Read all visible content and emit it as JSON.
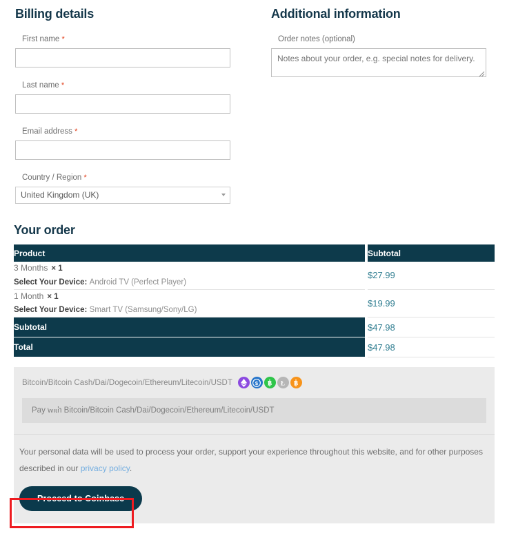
{
  "billing": {
    "title": "Billing details",
    "fields": [
      {
        "label": "First name",
        "required": "*",
        "value": "",
        "placeholder": ""
      },
      {
        "label": "Last name",
        "required": "*",
        "value": "",
        "placeholder": ""
      },
      {
        "label": "Email address",
        "required": "*",
        "value": "",
        "placeholder": ""
      }
    ],
    "country": {
      "label": "Country / Region",
      "required": "*",
      "selected": "United Kingdom (UK)",
      "caret_icon": "chevron-down-icon"
    }
  },
  "additional": {
    "title": "Additional information",
    "notes_label": "Order notes (optional)",
    "notes_value": "",
    "notes_placeholder": "Notes about your order, e.g. special notes for delivery.",
    "resize_icon": "resize-grip-icon"
  },
  "order": {
    "title": "Your order",
    "columns": {
      "product": "Product",
      "subtotal": "Subtotal"
    },
    "items": [
      {
        "name": "3 Months",
        "qty": "× 1",
        "meta_key": "Select Your Device:",
        "meta_value": "Android TV (Perfect Player)",
        "subtotal": "$27.99"
      },
      {
        "name": "1 Month",
        "qty": "× 1",
        "meta_key": "Select Your Device:",
        "meta_value": "Smart TV (Samsung/Sony/LG)",
        "subtotal": "$19.99"
      }
    ],
    "totals": [
      {
        "label": "Subtotal",
        "value": "$47.98"
      },
      {
        "label": "Total",
        "value": "$47.98"
      }
    ]
  },
  "payment": {
    "method_label": "Bitcoin/Bitcoin Cash/Dai/Dogecoin/Ethereum/Litecoin/USDT",
    "description": "Pay with Bitcoin/Bitcoin Cash/Dai/Dogecoin/Ethereum/Litecoin/USDT",
    "coins": [
      {
        "name": "ethereum-icon",
        "symbol": "♦",
        "color": "#8c4ae0"
      },
      {
        "name": "dai-icon",
        "symbol": "$",
        "color": "#2775ca"
      },
      {
        "name": "bitcoin-cash-icon",
        "symbol": "Ƀ",
        "color": "#2fc54a"
      },
      {
        "name": "litecoin-icon",
        "symbol": "Ł",
        "color": "#b6b6b6"
      },
      {
        "name": "bitcoin-icon",
        "symbol": "Ƀ",
        "color": "#f7931a"
      }
    ],
    "privacy_text_before": "Your personal data will be used to process your order, support your experience throughout this website, and for other purposes described in our ",
    "privacy_link": "privacy policy",
    "privacy_text_after": ".",
    "place_order_label": "Proceed to Coinbase"
  },
  "colors": {
    "heading": "#14374a",
    "table_header_bg": "#0d3a4b",
    "price": "#317e91",
    "button_bg": "#0b3a4c",
    "link": "#74aee0",
    "annotation": "#ee1b20",
    "panel_bg": "#ebebeb"
  }
}
